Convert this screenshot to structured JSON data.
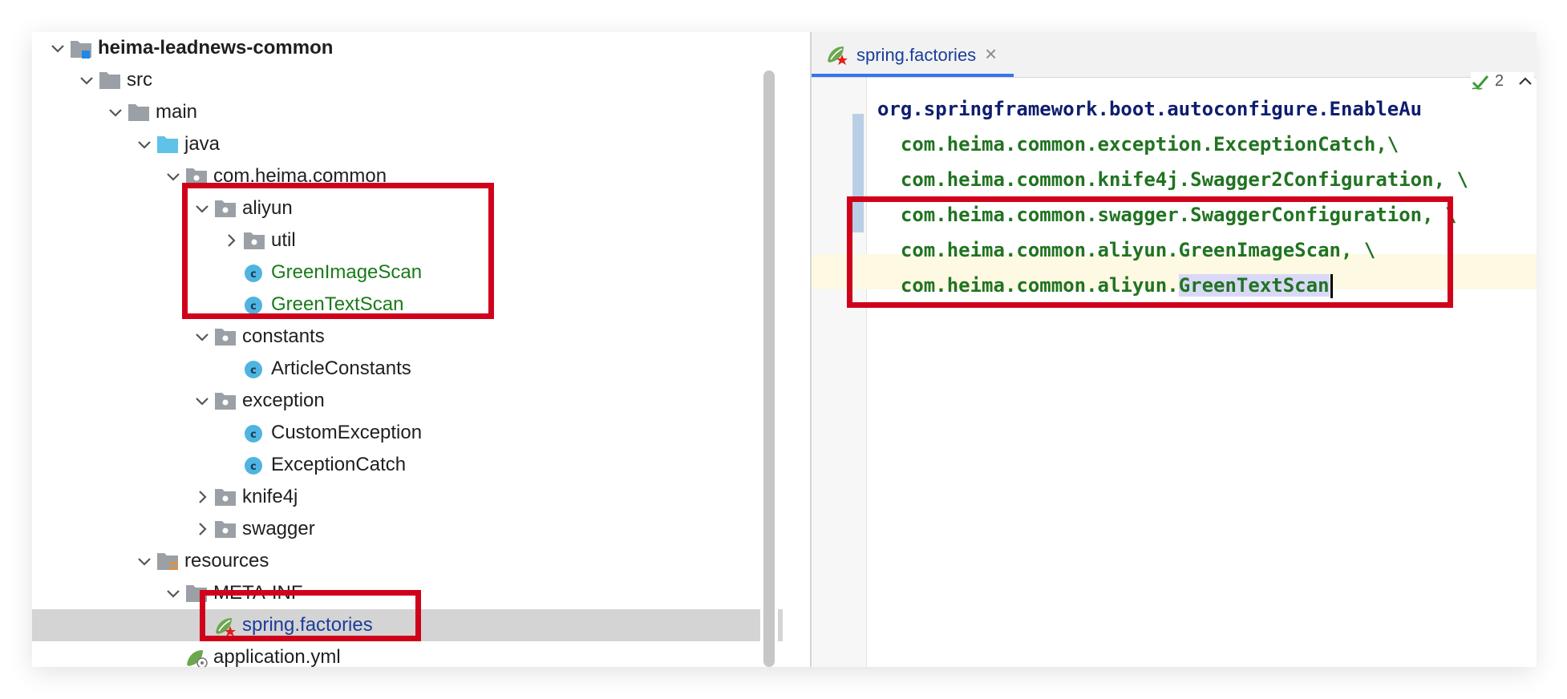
{
  "project_tree": {
    "items": [
      {
        "label": "heima-leadnews-common",
        "icon": "module-folder-icon",
        "chevron": "down",
        "style": "bold"
      },
      {
        "label": "src",
        "icon": "folder-icon",
        "chevron": "down",
        "style": "normal"
      },
      {
        "label": "main",
        "icon": "folder-icon",
        "chevron": "down",
        "style": "normal"
      },
      {
        "label": "java",
        "icon": "source-root-folder-icon",
        "chevron": "down",
        "style": "normal"
      },
      {
        "label": "com.heima.common",
        "icon": "package-icon",
        "chevron": "down",
        "style": "normal"
      },
      {
        "label": "aliyun",
        "icon": "package-icon",
        "chevron": "down",
        "style": "normal"
      },
      {
        "label": "util",
        "icon": "package-icon",
        "chevron": "right",
        "style": "normal"
      },
      {
        "label": "GreenImageScan",
        "icon": "java-class-icon",
        "chevron": "none",
        "style": "green"
      },
      {
        "label": "GreenTextScan",
        "icon": "java-class-icon",
        "chevron": "none",
        "style": "green"
      },
      {
        "label": "constants",
        "icon": "package-icon",
        "chevron": "down",
        "style": "normal"
      },
      {
        "label": "ArticleConstants",
        "icon": "java-class-icon",
        "chevron": "none",
        "style": "normal"
      },
      {
        "label": "exception",
        "icon": "package-icon",
        "chevron": "down",
        "style": "normal"
      },
      {
        "label": "CustomException",
        "icon": "java-class-icon",
        "chevron": "none",
        "style": "normal"
      },
      {
        "label": "ExceptionCatch",
        "icon": "java-class-icon",
        "chevron": "none",
        "style": "normal"
      },
      {
        "label": "knife4j",
        "icon": "package-icon",
        "chevron": "right",
        "style": "normal"
      },
      {
        "label": "swagger",
        "icon": "package-icon",
        "chevron": "right",
        "style": "normal"
      },
      {
        "label": "resources",
        "icon": "resources-folder-icon",
        "chevron": "down",
        "style": "normal"
      },
      {
        "label": "META-INF",
        "icon": "folder-icon",
        "chevron": "down",
        "style": "normal"
      },
      {
        "label": "spring.factories",
        "icon": "spring-factories-icon",
        "chevron": "none",
        "style": "blue",
        "selected": true
      },
      {
        "label": "application.yml",
        "icon": "spring-yml-icon",
        "chevron": "none",
        "style": "normal"
      }
    ]
  },
  "editor": {
    "tab_label": "spring.factories",
    "inspection_count": "2",
    "lines": [
      {
        "text": "org.springframework.boot.autoconfigure.EnableAu",
        "color": "blue"
      },
      {
        "text": "  com.heima.common.exception.ExceptionCatch,\\",
        "color": "green"
      },
      {
        "text": "  com.heima.common.knife4j.Swagger2Configuration, \\",
        "color": "green"
      },
      {
        "text": "  com.heima.common.swagger.SwaggerConfiguration, \\",
        "color": "green"
      },
      {
        "text": "  com.heima.common.aliyun.GreenImageScan, \\",
        "color": "green"
      },
      {
        "text_prefix": "  com.heima.common.aliyun.",
        "text_selected": "GreenTextScan",
        "color": "green"
      }
    ]
  },
  "colors": {
    "annotation_red": "#d0021b",
    "selection_gray": "#d4d4d4",
    "class_icon_blue": "#4fb4e0",
    "folder_gray": "#9aa0a6",
    "source_folder_blue": "#5ec3e6"
  }
}
